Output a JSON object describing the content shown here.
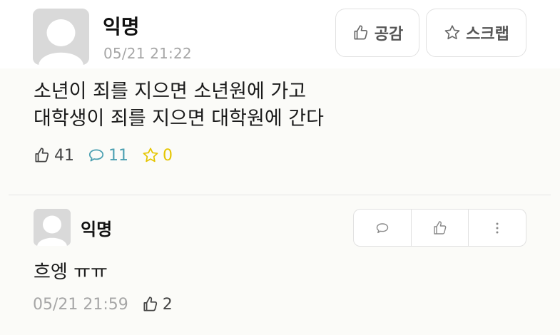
{
  "post": {
    "author": "익명",
    "time": "05/21 21:22",
    "like_button_label": "공감",
    "scrap_button_label": "스크랩",
    "body_lines": [
      "소년이 죄를 지으면 소년원에 가고",
      "대학생이 죄를 지으면 대학원에 간다"
    ],
    "stats": {
      "likes": "41",
      "comments": "11",
      "scraps": "0"
    }
  },
  "comment": {
    "author": "익명",
    "text": "흐엥 ㅠㅠ",
    "time": "05/21 21:59",
    "likes": "2"
  },
  "icons": {
    "avatar": "default-profile-icon",
    "like": "thumbs-up-icon",
    "scrap": "star-icon",
    "comment": "speech-bubble-icon",
    "more": "vertical-ellipsis-icon"
  },
  "colors": {
    "comment_count": "#4a9fb1",
    "scrap_count": "#e5c500",
    "muted_text": "#a6a6a6"
  }
}
